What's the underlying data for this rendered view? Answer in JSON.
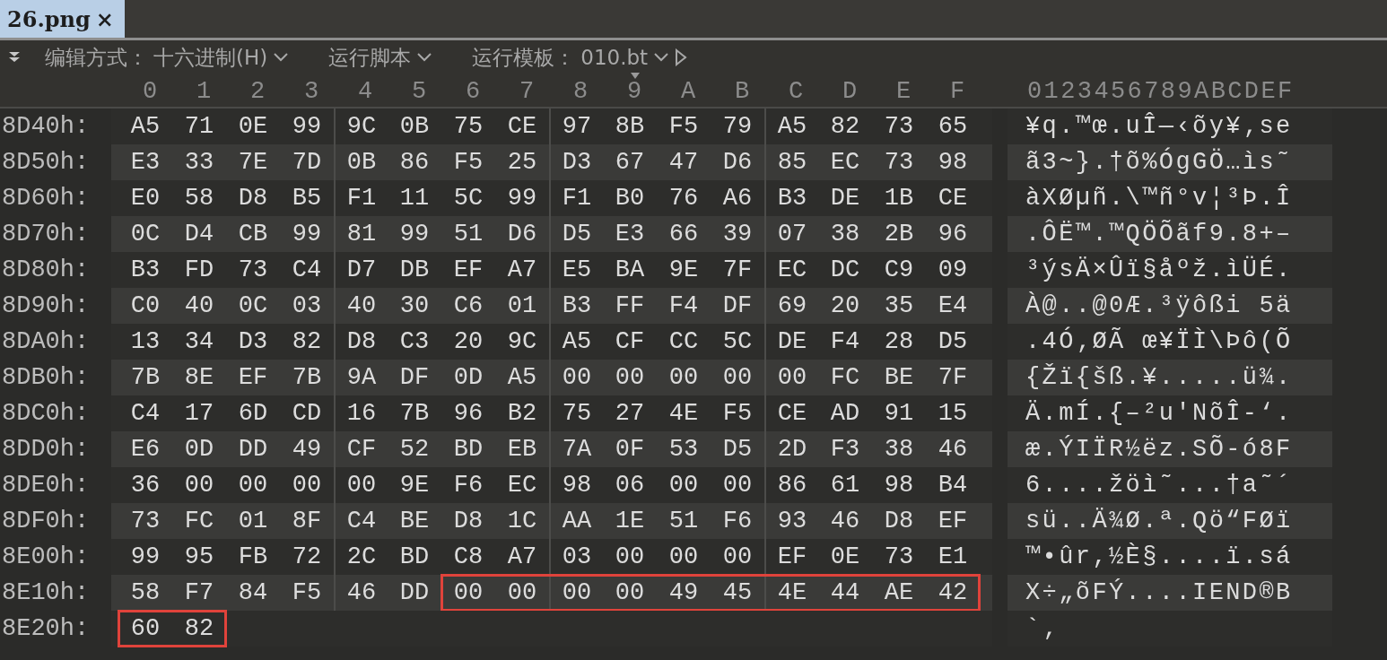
{
  "tabs": [
    {
      "label": "26.png",
      "close": "×",
      "selected": true
    }
  ],
  "toolbar": {
    "edit_as_label": "编辑方式：",
    "edit_as_value": "十六进制(H)",
    "run_script": "运行脚本",
    "run_template_label": "运行模板：",
    "run_template_value": "010.bt"
  },
  "hex_header": [
    {
      "label": "0",
      "current": false
    },
    {
      "label": "1",
      "current": false
    },
    {
      "label": "2",
      "current": false
    },
    {
      "label": "3",
      "current": false
    },
    {
      "label": "4",
      "current": false
    },
    {
      "label": "5",
      "current": false
    },
    {
      "label": "6",
      "current": false
    },
    {
      "label": "7",
      "current": false
    },
    {
      "label": "8",
      "current": false
    },
    {
      "label": "9",
      "current": true
    },
    {
      "label": "A",
      "current": false
    },
    {
      "label": "B",
      "current": false
    },
    {
      "label": "C",
      "current": false
    },
    {
      "label": "D",
      "current": false
    },
    {
      "label": "E",
      "current": false
    },
    {
      "label": "F",
      "current": false
    }
  ],
  "ascii_header": "0123456789ABCDEF",
  "rows": [
    {
      "address": "8D40h:",
      "groups": [
        {
          "marked": false,
          "bytes": [
            "A5",
            "71",
            "0E",
            "99",
            "9C",
            "0B",
            "75",
            "CE",
            "97",
            "8B",
            "F5",
            "79",
            "A5",
            "82",
            "73",
            "65"
          ]
        }
      ],
      "ascii": "¥q.™œ.uÎ—‹õy¥‚se"
    },
    {
      "address": "8D50h:",
      "groups": [
        {
          "marked": false,
          "bytes": [
            "E3",
            "33",
            "7E",
            "7D",
            "0B",
            "86",
            "F5",
            "25",
            "D3",
            "67",
            "47",
            "D6",
            "85",
            "EC",
            "73",
            "98"
          ]
        }
      ],
      "ascii": "ã3~}.†õ%ÓgGÖ…ìs˜"
    },
    {
      "address": "8D60h:",
      "groups": [
        {
          "marked": false,
          "bytes": [
            "E0",
            "58",
            "D8",
            "B5",
            "F1",
            "11",
            "5C",
            "99",
            "F1",
            "B0",
            "76",
            "A6",
            "B3",
            "DE",
            "1B",
            "CE"
          ]
        }
      ],
      "ascii": "àXØµñ.\\™ñ°v¦³Þ.Î"
    },
    {
      "address": "8D70h:",
      "groups": [
        {
          "marked": false,
          "bytes": [
            "0C",
            "D4",
            "CB",
            "99",
            "81",
            "99",
            "51",
            "D6",
            "D5",
            "E3",
            "66",
            "39",
            "07",
            "38",
            "2B",
            "96"
          ]
        }
      ],
      "ascii": ".ÔË™.™QÖÕãf9.8+–"
    },
    {
      "address": "8D80h:",
      "groups": [
        {
          "marked": false,
          "bytes": [
            "B3",
            "FD",
            "73",
            "C4",
            "D7",
            "DB",
            "EF",
            "A7",
            "E5",
            "BA",
            "9E",
            "7F",
            "EC",
            "DC",
            "C9",
            "09"
          ]
        }
      ],
      "ascii": "³ýsÄ×Ûï§åºž.ìÜÉ."
    },
    {
      "address": "8D90h:",
      "groups": [
        {
          "marked": false,
          "bytes": [
            "C0",
            "40",
            "0C",
            "03",
            "40",
            "30",
            "C6",
            "01",
            "B3",
            "FF",
            "F4",
            "DF",
            "69",
            "20",
            "35",
            "E4"
          ]
        }
      ],
      "ascii": "À@..@0Æ.³ÿôßi 5ä"
    },
    {
      "address": "8DA0h:",
      "groups": [
        {
          "marked": false,
          "bytes": [
            "13",
            "34",
            "D3",
            "82",
            "D8",
            "C3",
            "20",
            "9C",
            "A5",
            "CF",
            "CC",
            "5C",
            "DE",
            "F4",
            "28",
            "D5"
          ]
        }
      ],
      "ascii": ".4Ó‚ØÃ œ¥ÏÌ\\Þô(Õ"
    },
    {
      "address": "8DB0h:",
      "groups": [
        {
          "marked": false,
          "bytes": [
            "7B",
            "8E",
            "EF",
            "7B",
            "9A",
            "DF",
            "0D",
            "A5",
            "00",
            "00",
            "00",
            "00",
            "00",
            "FC",
            "BE",
            "7F"
          ]
        }
      ],
      "ascii": "{Žï{šß.¥.....ü¾."
    },
    {
      "address": "8DC0h:",
      "groups": [
        {
          "marked": false,
          "bytes": [
            "C4",
            "17",
            "6D",
            "CD",
            "16",
            "7B",
            "96",
            "B2",
            "75",
            "27",
            "4E",
            "F5",
            "CE",
            "AD",
            "91",
            "15"
          ]
        }
      ],
      "ascii": "Ä.mÍ.{–²u'NõÎ-‘."
    },
    {
      "address": "8DD0h:",
      "groups": [
        {
          "marked": false,
          "bytes": [
            "E6",
            "0D",
            "DD",
            "49",
            "CF",
            "52",
            "BD",
            "EB",
            "7A",
            "0F",
            "53",
            "D5",
            "2D",
            "F3",
            "38",
            "46"
          ]
        }
      ],
      "ascii": "æ.ÝIÏR½ëz.SÕ-ó8F"
    },
    {
      "address": "8DE0h:",
      "groups": [
        {
          "marked": false,
          "bytes": [
            "36",
            "00",
            "00",
            "00",
            "00",
            "9E",
            "F6",
            "EC",
            "98",
            "06",
            "00",
            "00",
            "86",
            "61",
            "98",
            "B4"
          ]
        }
      ],
      "ascii": "6....žöì˜...†a˜´"
    },
    {
      "address": "8DF0h:",
      "groups": [
        {
          "marked": false,
          "bytes": [
            "73",
            "FC",
            "01",
            "8F",
            "C4",
            "BE",
            "D8",
            "1C",
            "AA",
            "1E",
            "51",
            "F6",
            "93",
            "46",
            "D8",
            "EF"
          ]
        }
      ],
      "ascii": "sü..Ä¾Ø.ª.Qö“FØï"
    },
    {
      "address": "8E00h:",
      "groups": [
        {
          "marked": false,
          "bytes": [
            "99",
            "95",
            "FB",
            "72",
            "2C",
            "BD",
            "C8",
            "A7",
            "03",
            "00",
            "00",
            "00",
            "EF",
            "0E",
            "73",
            "E1"
          ]
        }
      ],
      "ascii": "™•ûr,½È§....ï.sá"
    },
    {
      "address": "8E10h:",
      "groups": [
        {
          "marked": false,
          "bytes": [
            "58",
            "F7",
            "84",
            "F5",
            "46",
            "DD"
          ]
        },
        {
          "marked": true,
          "bytes": [
            "00",
            "00",
            "00",
            "00",
            "49",
            "45",
            "4E",
            "44",
            "AE",
            "42"
          ]
        }
      ],
      "ascii": "X÷„õFÝ....IEND®B"
    },
    {
      "address": "8E20h:",
      "groups": [
        {
          "marked": true,
          "bytes": [
            "60",
            "82"
          ]
        }
      ],
      "ascii": "`‚"
    }
  ]
}
